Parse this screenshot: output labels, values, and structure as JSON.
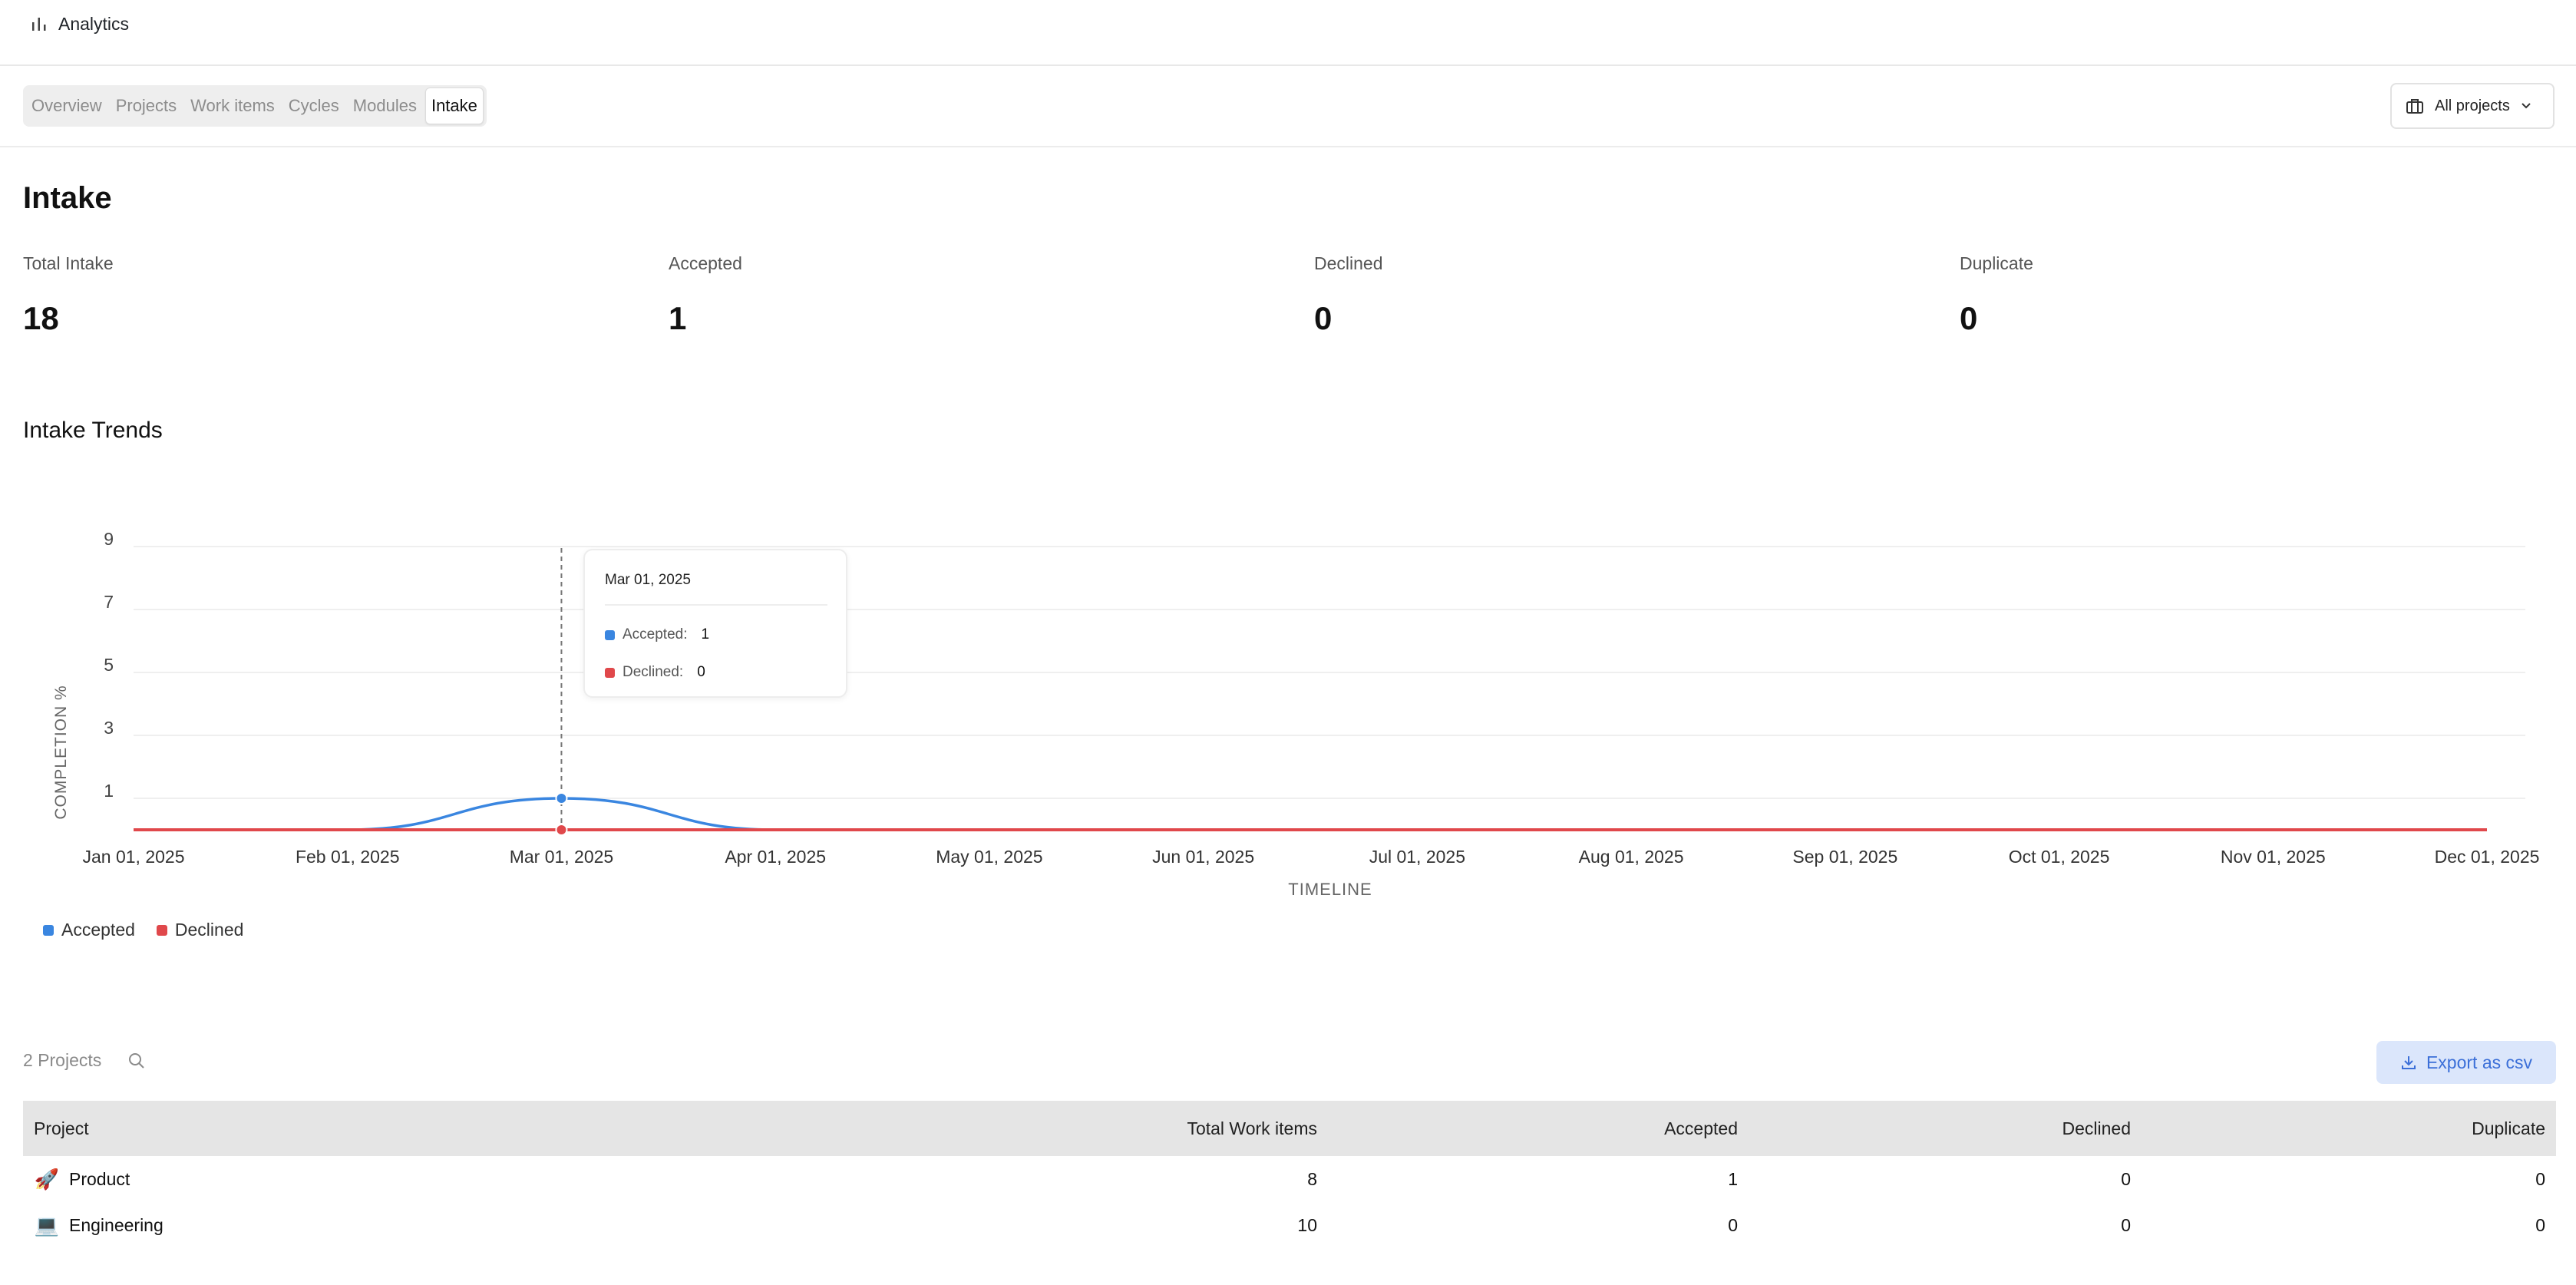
{
  "app": {
    "title": "Analytics",
    "icon": "bar-chart-icon"
  },
  "tabs": [
    {
      "label": "Overview",
      "active": false
    },
    {
      "label": "Projects",
      "active": false
    },
    {
      "label": "Work items",
      "active": false
    },
    {
      "label": "Cycles",
      "active": false
    },
    {
      "label": "Modules",
      "active": false
    },
    {
      "label": "Intake",
      "active": true
    }
  ],
  "project_filter": {
    "label": "All projects",
    "icon": "briefcase-icon"
  },
  "section": {
    "title": "Intake"
  },
  "stats": [
    {
      "label": "Total Intake",
      "value": "18"
    },
    {
      "label": "Accepted",
      "value": "1"
    },
    {
      "label": "Declined",
      "value": "0"
    },
    {
      "label": "Duplicate",
      "value": "0"
    }
  ],
  "trends": {
    "title": "Intake Trends"
  },
  "tooltip": {
    "date": "Mar 01, 2025",
    "rows": [
      {
        "label": "Accepted:",
        "value": "1",
        "color": "#3a86e0"
      },
      {
        "label": "Declined:",
        "value": "0",
        "color": "#e0484b"
      }
    ]
  },
  "chart_data": {
    "type": "area",
    "xlabel": "TIMELINE",
    "ylabel": "COMPLETION %",
    "categories": [
      "Jan 01, 2025",
      "Feb 01, 2025",
      "Mar 01, 2025",
      "Apr 01, 2025",
      "May 01, 2025",
      "Jun 01, 2025",
      "Jul 01, 2025",
      "Aug 01, 2025",
      "Sep 01, 2025",
      "Oct 01, 2025",
      "Nov 01, 2025",
      "Dec 01, 2025"
    ],
    "yticks": [
      1,
      3,
      5,
      7,
      9
    ],
    "ylim": [
      0,
      9
    ],
    "series": [
      {
        "name": "Accepted",
        "color": "#3a86e0",
        "values": [
          0,
          0,
          1,
          0,
          0,
          0,
          0,
          0,
          0,
          0,
          0,
          0
        ]
      },
      {
        "name": "Declined",
        "color": "#e0484b",
        "values": [
          0,
          0,
          0,
          0,
          0,
          0,
          0,
          0,
          0,
          0,
          0,
          0
        ]
      }
    ],
    "highlight_index": 2,
    "grid": true,
    "legend": "bottom-left"
  },
  "table": {
    "count_label": "2 Projects",
    "export_label": "Export as csv",
    "headers": [
      "Project",
      "Total Work items",
      "Accepted",
      "Declined",
      "Duplicate"
    ],
    "rows": [
      {
        "emoji": "🚀",
        "name": "Product",
        "total": "8",
        "accepted": "1",
        "declined": "0",
        "duplicate": "0"
      },
      {
        "emoji": "💻",
        "name": "Engineering",
        "total": "10",
        "accepted": "0",
        "declined": "0",
        "duplicate": "0"
      }
    ]
  }
}
